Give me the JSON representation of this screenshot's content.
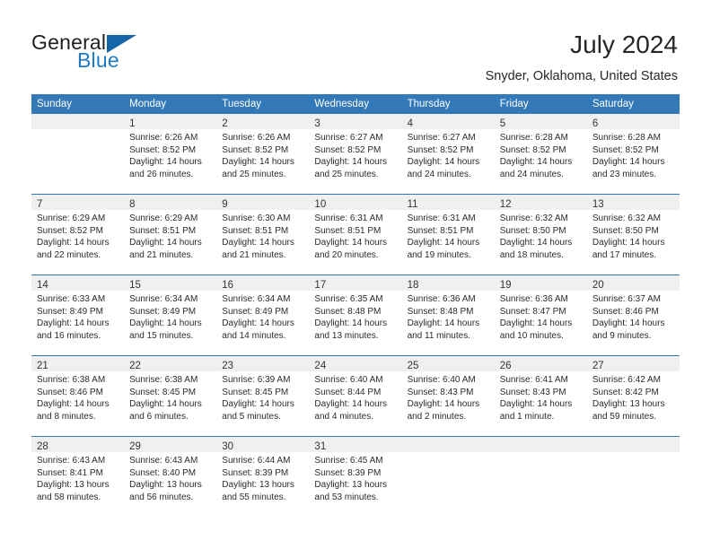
{
  "brand": {
    "word1": "General",
    "word2": "Blue",
    "triangle_color": "#1565a8",
    "blue_text_color": "#1f7ac4"
  },
  "header": {
    "title": "July 2024",
    "location": "Snyder, Oklahoma, United States"
  },
  "theme": {
    "header_row_bg": "#3379b8",
    "daynum_band_bg": "#f0f0f0",
    "row_divider": "#3379b8",
    "text": "#2b2b2b"
  },
  "calendar": {
    "weekday_headers": [
      "Sunday",
      "Monday",
      "Tuesday",
      "Wednesday",
      "Thursday",
      "Friday",
      "Saturday"
    ],
    "weeks": [
      [
        {
          "day": "",
          "sunrise": "",
          "sunset": "",
          "daylight1": "",
          "daylight2": ""
        },
        {
          "day": "1",
          "sunrise": "Sunrise: 6:26 AM",
          "sunset": "Sunset: 8:52 PM",
          "daylight1": "Daylight: 14 hours",
          "daylight2": "and 26 minutes."
        },
        {
          "day": "2",
          "sunrise": "Sunrise: 6:26 AM",
          "sunset": "Sunset: 8:52 PM",
          "daylight1": "Daylight: 14 hours",
          "daylight2": "and 25 minutes."
        },
        {
          "day": "3",
          "sunrise": "Sunrise: 6:27 AM",
          "sunset": "Sunset: 8:52 PM",
          "daylight1": "Daylight: 14 hours",
          "daylight2": "and 25 minutes."
        },
        {
          "day": "4",
          "sunrise": "Sunrise: 6:27 AM",
          "sunset": "Sunset: 8:52 PM",
          "daylight1": "Daylight: 14 hours",
          "daylight2": "and 24 minutes."
        },
        {
          "day": "5",
          "sunrise": "Sunrise: 6:28 AM",
          "sunset": "Sunset: 8:52 PM",
          "daylight1": "Daylight: 14 hours",
          "daylight2": "and 24 minutes."
        },
        {
          "day": "6",
          "sunrise": "Sunrise: 6:28 AM",
          "sunset": "Sunset: 8:52 PM",
          "daylight1": "Daylight: 14 hours",
          "daylight2": "and 23 minutes."
        }
      ],
      [
        {
          "day": "7",
          "sunrise": "Sunrise: 6:29 AM",
          "sunset": "Sunset: 8:52 PM",
          "daylight1": "Daylight: 14 hours",
          "daylight2": "and 22 minutes."
        },
        {
          "day": "8",
          "sunrise": "Sunrise: 6:29 AM",
          "sunset": "Sunset: 8:51 PM",
          "daylight1": "Daylight: 14 hours",
          "daylight2": "and 21 minutes."
        },
        {
          "day": "9",
          "sunrise": "Sunrise: 6:30 AM",
          "sunset": "Sunset: 8:51 PM",
          "daylight1": "Daylight: 14 hours",
          "daylight2": "and 21 minutes."
        },
        {
          "day": "10",
          "sunrise": "Sunrise: 6:31 AM",
          "sunset": "Sunset: 8:51 PM",
          "daylight1": "Daylight: 14 hours",
          "daylight2": "and 20 minutes."
        },
        {
          "day": "11",
          "sunrise": "Sunrise: 6:31 AM",
          "sunset": "Sunset: 8:51 PM",
          "daylight1": "Daylight: 14 hours",
          "daylight2": "and 19 minutes."
        },
        {
          "day": "12",
          "sunrise": "Sunrise: 6:32 AM",
          "sunset": "Sunset: 8:50 PM",
          "daylight1": "Daylight: 14 hours",
          "daylight2": "and 18 minutes."
        },
        {
          "day": "13",
          "sunrise": "Sunrise: 6:32 AM",
          "sunset": "Sunset: 8:50 PM",
          "daylight1": "Daylight: 14 hours",
          "daylight2": "and 17 minutes."
        }
      ],
      [
        {
          "day": "14",
          "sunrise": "Sunrise: 6:33 AM",
          "sunset": "Sunset: 8:49 PM",
          "daylight1": "Daylight: 14 hours",
          "daylight2": "and 16 minutes."
        },
        {
          "day": "15",
          "sunrise": "Sunrise: 6:34 AM",
          "sunset": "Sunset: 8:49 PM",
          "daylight1": "Daylight: 14 hours",
          "daylight2": "and 15 minutes."
        },
        {
          "day": "16",
          "sunrise": "Sunrise: 6:34 AM",
          "sunset": "Sunset: 8:49 PM",
          "daylight1": "Daylight: 14 hours",
          "daylight2": "and 14 minutes."
        },
        {
          "day": "17",
          "sunrise": "Sunrise: 6:35 AM",
          "sunset": "Sunset: 8:48 PM",
          "daylight1": "Daylight: 14 hours",
          "daylight2": "and 13 minutes."
        },
        {
          "day": "18",
          "sunrise": "Sunrise: 6:36 AM",
          "sunset": "Sunset: 8:48 PM",
          "daylight1": "Daylight: 14 hours",
          "daylight2": "and 11 minutes."
        },
        {
          "day": "19",
          "sunrise": "Sunrise: 6:36 AM",
          "sunset": "Sunset: 8:47 PM",
          "daylight1": "Daylight: 14 hours",
          "daylight2": "and 10 minutes."
        },
        {
          "day": "20",
          "sunrise": "Sunrise: 6:37 AM",
          "sunset": "Sunset: 8:46 PM",
          "daylight1": "Daylight: 14 hours",
          "daylight2": "and 9 minutes."
        }
      ],
      [
        {
          "day": "21",
          "sunrise": "Sunrise: 6:38 AM",
          "sunset": "Sunset: 8:46 PM",
          "daylight1": "Daylight: 14 hours",
          "daylight2": "and 8 minutes."
        },
        {
          "day": "22",
          "sunrise": "Sunrise: 6:38 AM",
          "sunset": "Sunset: 8:45 PM",
          "daylight1": "Daylight: 14 hours",
          "daylight2": "and 6 minutes."
        },
        {
          "day": "23",
          "sunrise": "Sunrise: 6:39 AM",
          "sunset": "Sunset: 8:45 PM",
          "daylight1": "Daylight: 14 hours",
          "daylight2": "and 5 minutes."
        },
        {
          "day": "24",
          "sunrise": "Sunrise: 6:40 AM",
          "sunset": "Sunset: 8:44 PM",
          "daylight1": "Daylight: 14 hours",
          "daylight2": "and 4 minutes."
        },
        {
          "day": "25",
          "sunrise": "Sunrise: 6:40 AM",
          "sunset": "Sunset: 8:43 PM",
          "daylight1": "Daylight: 14 hours",
          "daylight2": "and 2 minutes."
        },
        {
          "day": "26",
          "sunrise": "Sunrise: 6:41 AM",
          "sunset": "Sunset: 8:43 PM",
          "daylight1": "Daylight: 14 hours",
          "daylight2": "and 1 minute."
        },
        {
          "day": "27",
          "sunrise": "Sunrise: 6:42 AM",
          "sunset": "Sunset: 8:42 PM",
          "daylight1": "Daylight: 13 hours",
          "daylight2": "and 59 minutes."
        }
      ],
      [
        {
          "day": "28",
          "sunrise": "Sunrise: 6:43 AM",
          "sunset": "Sunset: 8:41 PM",
          "daylight1": "Daylight: 13 hours",
          "daylight2": "and 58 minutes."
        },
        {
          "day": "29",
          "sunrise": "Sunrise: 6:43 AM",
          "sunset": "Sunset: 8:40 PM",
          "daylight1": "Daylight: 13 hours",
          "daylight2": "and 56 minutes."
        },
        {
          "day": "30",
          "sunrise": "Sunrise: 6:44 AM",
          "sunset": "Sunset: 8:39 PM",
          "daylight1": "Daylight: 13 hours",
          "daylight2": "and 55 minutes."
        },
        {
          "day": "31",
          "sunrise": "Sunrise: 6:45 AM",
          "sunset": "Sunset: 8:39 PM",
          "daylight1": "Daylight: 13 hours",
          "daylight2": "and 53 minutes."
        },
        {
          "day": "",
          "sunrise": "",
          "sunset": "",
          "daylight1": "",
          "daylight2": ""
        },
        {
          "day": "",
          "sunrise": "",
          "sunset": "",
          "daylight1": "",
          "daylight2": ""
        },
        {
          "day": "",
          "sunrise": "",
          "sunset": "",
          "daylight1": "",
          "daylight2": ""
        }
      ]
    ]
  }
}
